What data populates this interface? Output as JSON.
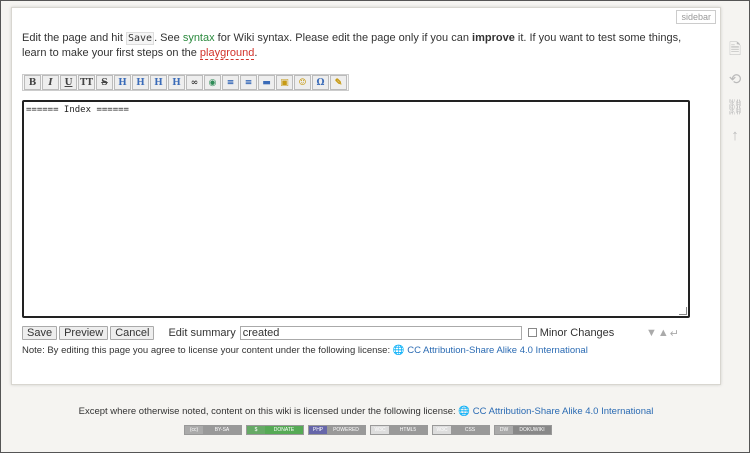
{
  "page_tab": "sidebar",
  "intro": {
    "t1": "Edit the page and hit ",
    "save_code": "Save",
    "t2": ". See ",
    "syntax_link": "syntax",
    "t3": " for Wiki syntax. Please edit the page only if you can ",
    "improve": "improve",
    "t4": " it. If you want to test some things, learn to make your first steps on the ",
    "playground_link": "playground",
    "t5": "."
  },
  "toolbar": [
    {
      "name": "bold-icon",
      "glyph": "B"
    },
    {
      "name": "italic-icon",
      "glyph": "I"
    },
    {
      "name": "underline-icon",
      "glyph": "U"
    },
    {
      "name": "monospace-icon",
      "glyph": "TT"
    },
    {
      "name": "strikethrough-icon",
      "glyph": "S"
    },
    {
      "name": "heading-same-icon",
      "glyph": "H"
    },
    {
      "name": "heading-lower-icon",
      "glyph": "H"
    },
    {
      "name": "heading-higher-icon",
      "glyph": "H"
    },
    {
      "name": "heading-menu-icon",
      "glyph": "H"
    },
    {
      "name": "link-icon",
      "glyph": "∞"
    },
    {
      "name": "external-link-icon",
      "glyph": "◉"
    },
    {
      "name": "ordered-list-icon",
      "glyph": "≡"
    },
    {
      "name": "unordered-list-icon",
      "glyph": "≡"
    },
    {
      "name": "horizontal-rule-icon",
      "glyph": "▬"
    },
    {
      "name": "media-icon",
      "glyph": "▣"
    },
    {
      "name": "smiley-icon",
      "glyph": "☺"
    },
    {
      "name": "special-chars-icon",
      "glyph": "Ω"
    },
    {
      "name": "signature-icon",
      "glyph": "✎"
    }
  ],
  "editor": {
    "content": "====== Index ======"
  },
  "controls": {
    "save_label": "Save",
    "preview_label": "Preview",
    "cancel_label": "Cancel",
    "summary_label": "Edit summary",
    "summary_value": "created",
    "minor_label": "Minor Changes"
  },
  "note": {
    "text": "Note: By editing this page you agree to license your content under the following license:",
    "license_link": "CC Attribution-Share Alike 4.0 International"
  },
  "footer": {
    "text": "Except where otherwise noted, content on this wiki is licensed under the following license:",
    "license_link": "CC Attribution-Share Alike 4.0 International"
  },
  "badges": [
    {
      "name": "cc-badge",
      "left": "(cc)",
      "right": "BY-SA",
      "lc": "#aaa",
      "rc": "#999"
    },
    {
      "name": "donate-badge",
      "left": "$",
      "right": "DONATE",
      "lc": "#6a6",
      "rc": "#5a5"
    },
    {
      "name": "php-badge",
      "left": "PHP",
      "right": "POWERED",
      "lc": "#66a",
      "rc": "#999"
    },
    {
      "name": "html5-badge",
      "left": "W3C",
      "right": "HTML5",
      "lc": "#ddd",
      "rc": "#999"
    },
    {
      "name": "css-badge",
      "left": "W3C",
      "right": "CSS",
      "lc": "#ddd",
      "rc": "#999"
    },
    {
      "name": "dokuwiki-badge",
      "left": "DW",
      "right": "DOKUWIKI",
      "lc": "#aaa",
      "rc": "#888"
    }
  ],
  "side_icons": [
    "show-page-icon",
    "old-revisions-icon",
    "backlinks-icon",
    "back-to-top-icon"
  ]
}
